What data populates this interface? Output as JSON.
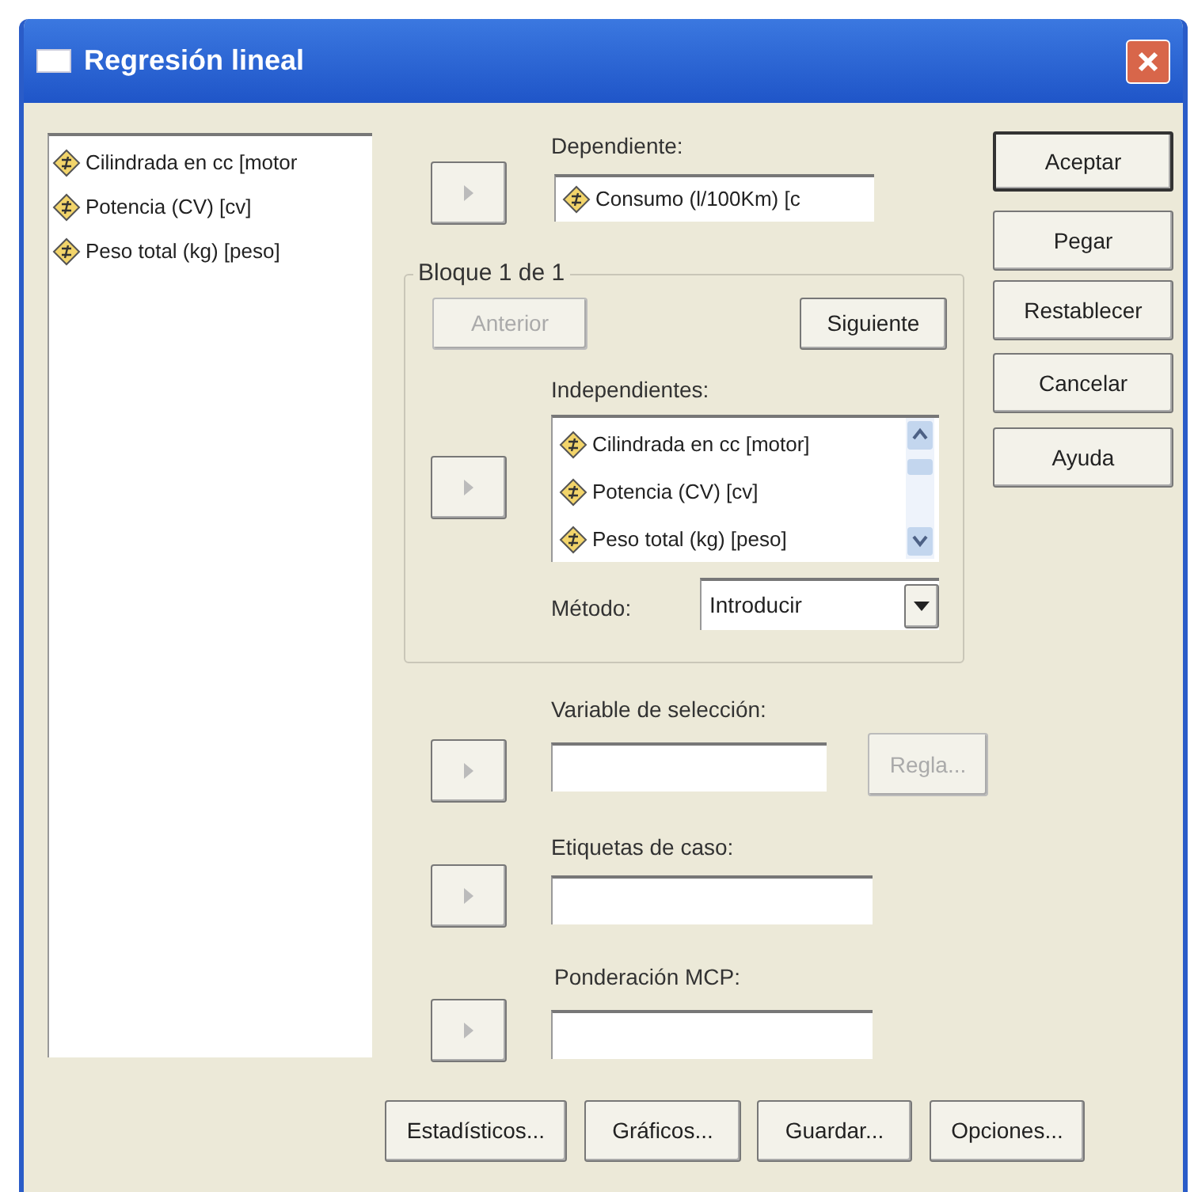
{
  "window": {
    "title": "Regresión lineal"
  },
  "source_variables": [
    {
      "label": "Cilindrada en cc [motor"
    },
    {
      "label": "Potencia (CV) [cv]"
    },
    {
      "label": "Peso total (kg) [peso]"
    }
  ],
  "dependent": {
    "label": "Dependiente:",
    "value": "Consumo (l/100Km) [c"
  },
  "block": {
    "title": "Bloque 1 de 1",
    "previous": {
      "label": "Anterior",
      "disabled": true
    },
    "next": {
      "label": "Siguiente",
      "disabled": false
    }
  },
  "independents": {
    "label": "Independientes:",
    "items": [
      {
        "label": "Cilindrada en cc [motor]"
      },
      {
        "label": "Potencia (CV) [cv]"
      },
      {
        "label": "Peso total (kg) [peso]"
      }
    ]
  },
  "method": {
    "label": "Método:",
    "value": "Introducir"
  },
  "selection_variable": {
    "label": "Variable de selección:",
    "rule_button": {
      "label": "Regla...",
      "disabled": true
    }
  },
  "case_labels": {
    "label": "Etiquetas de caso:"
  },
  "wls_weight": {
    "label": "Ponderación MCP:"
  },
  "side_buttons": [
    {
      "label": "Aceptar",
      "default": true
    },
    {
      "label": "Pegar",
      "default": false
    },
    {
      "label": "Restablecer",
      "default": false
    },
    {
      "label": "Cancelar",
      "default": false
    },
    {
      "label": "Ayuda",
      "default": false
    }
  ],
  "bottom_buttons": [
    {
      "label": "Estadísticos..."
    },
    {
      "label": "Gráficos..."
    },
    {
      "label": "Guardar..."
    },
    {
      "label": "Opciones..."
    }
  ]
}
